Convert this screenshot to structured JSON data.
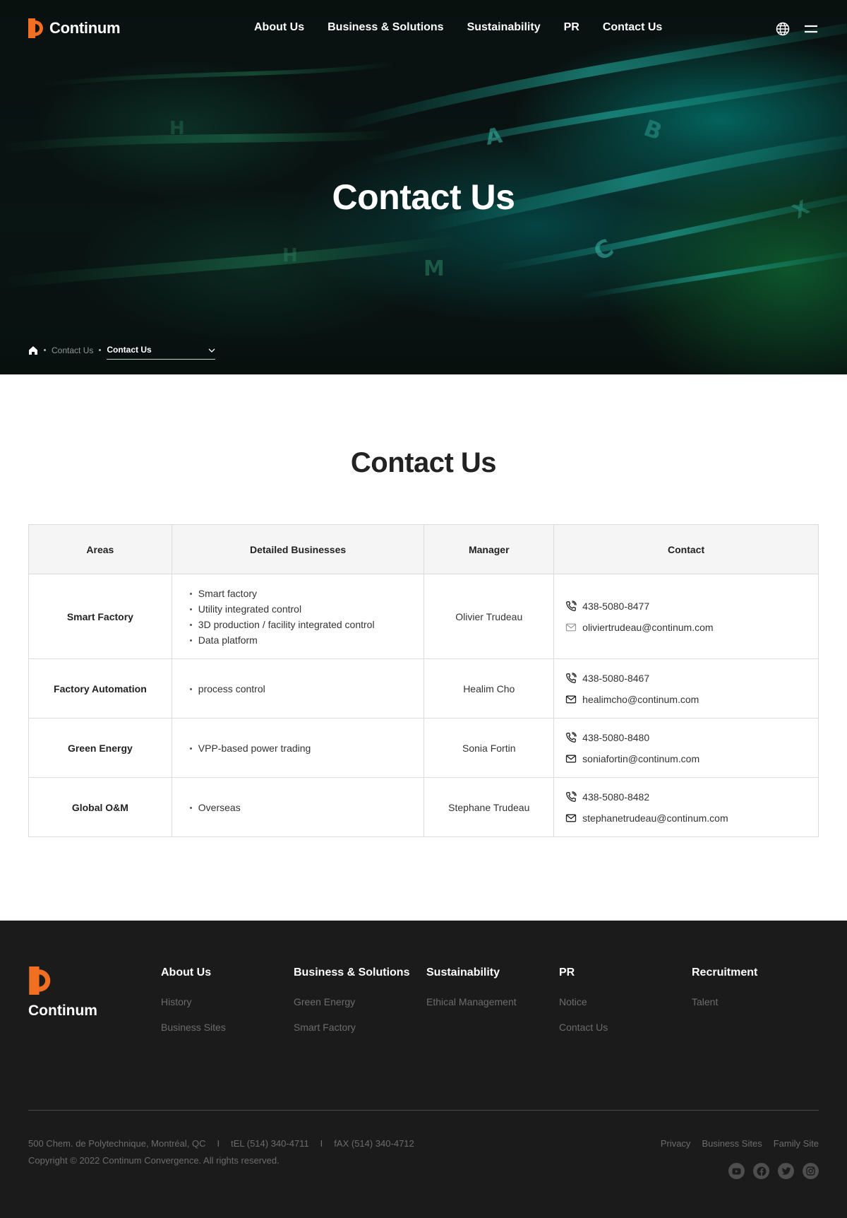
{
  "brand": {
    "name": "Continum",
    "accent": "#f26f21"
  },
  "nav": {
    "items": [
      "About Us",
      "Business & Solutions",
      "Sustainability",
      "PR",
      "Contact Us"
    ],
    "language_icon": "globe-icon",
    "menu_icon": "hamburger-icon"
  },
  "hero": {
    "title": "Contact Us",
    "breadcrumb": {
      "home_icon": "home-icon",
      "parent": "Contact Us",
      "current": "Contact Us"
    }
  },
  "main": {
    "title": "Contact Us",
    "table": {
      "headers": [
        "Areas",
        "Detailed Businesses",
        "Manager",
        "Contact"
      ],
      "rows": [
        {
          "area": "Smart Factory",
          "businesses": [
            "Smart factory",
            "Utility integrated control",
            "3D production / facility integrated control",
            "Data platform"
          ],
          "manager": "Olivier Trudeau",
          "phone": "438-5080-8477",
          "email": "oliviertrudeau@continum.com"
        },
        {
          "area": "Factory Automation",
          "businesses": [
            "process control"
          ],
          "manager": "Healim Cho",
          "phone": "438-5080-8467",
          "email": "healimcho@continum.com"
        },
        {
          "area": "Green Energy",
          "businesses": [
            "VPP-based power trading"
          ],
          "manager": "Sonia Fortin",
          "phone": "438-5080-8480",
          "email": "soniafortin@continum.com"
        },
        {
          "area": "Global O&M",
          "businesses": [
            "Overseas"
          ],
          "manager": "Stephane Trudeau",
          "phone": "438-5080-8482",
          "email": "stephanetrudeau@continum.com"
        }
      ]
    }
  },
  "footer": {
    "columns": [
      {
        "title": "About Us",
        "links": [
          "History",
          "Business Sites"
        ]
      },
      {
        "title": "Business & Solutions",
        "links": [
          "Green Energy",
          "Smart Factory"
        ]
      },
      {
        "title": "Sustainability",
        "links": [
          "Ethical Management"
        ]
      },
      {
        "title": "PR",
        "links": [
          "Notice",
          "Contact Us"
        ]
      },
      {
        "title": "Recruitment",
        "links": [
          "Talent"
        ]
      }
    ],
    "address": "500 Chem. de Polytechnique, Montréal, QC",
    "separator": "I",
    "tel": "tEL (514) 340-4711",
    "fax": "fAX (514) 340-4712",
    "copyright": "Copyright © 2022 Continum Convergence. All rights reserved.",
    "links": [
      "Privacy",
      "Business Sites",
      "Family Site"
    ],
    "social": [
      "youtube-icon",
      "facebook-icon",
      "twitter-icon",
      "instagram-icon"
    ],
    "colors": {
      "background": "#1b1b1b",
      "muted": "#6c6c6c"
    }
  }
}
